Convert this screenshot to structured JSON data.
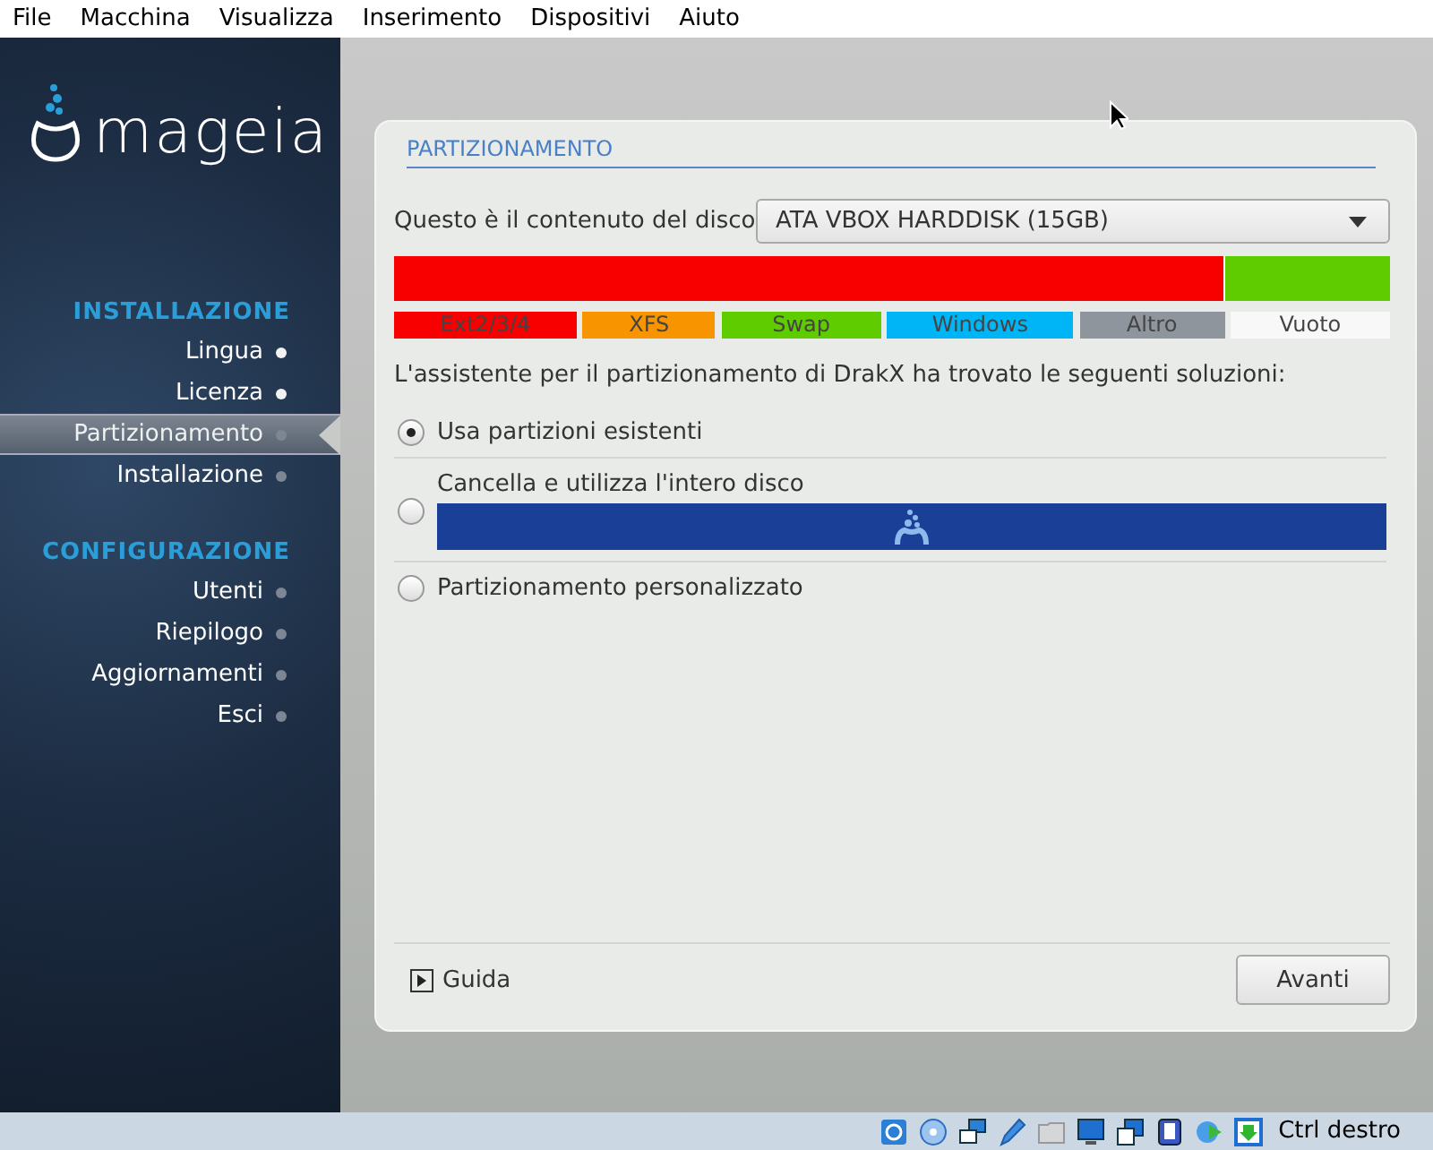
{
  "menu_bar": [
    "File",
    "Macchina",
    "Visualizza",
    "Inserimento",
    "Dispositivi",
    "Aiuto"
  ],
  "sidebar": {
    "logo_text": "mageia",
    "sections": [
      {
        "title": "INSTALLAZIONE",
        "items": [
          {
            "label": "Lingua",
            "done": true,
            "selected": false
          },
          {
            "label": "Licenza",
            "done": true,
            "selected": false
          },
          {
            "label": "Partizionamento",
            "done": false,
            "selected": true
          },
          {
            "label": "Installazione",
            "done": false,
            "selected": false
          }
        ]
      },
      {
        "title": "CONFIGURAZIONE",
        "items": [
          {
            "label": "Utenti",
            "done": false,
            "selected": false
          },
          {
            "label": "Riepilogo",
            "done": false,
            "selected": false
          },
          {
            "label": "Aggiornamenti",
            "done": false,
            "selected": false
          },
          {
            "label": "Esci",
            "done": false,
            "selected": false
          }
        ]
      }
    ]
  },
  "panel": {
    "title": "PARTIZIONAMENTO",
    "disk_label": "Questo è il contenuto del disco",
    "disk_select": "ATA VBOX HARDDISK (15GB)",
    "disk_bar": {
      "level": 0.835
    },
    "legend": [
      {
        "label": "Ext2/3/4",
        "color": "#f80000"
      },
      {
        "label": "XFS",
        "color": "#f79400"
      },
      {
        "label": "Swap",
        "color": "#5fcc00"
      },
      {
        "label": "Windows",
        "color": "#00b5f5"
      },
      {
        "label": "Altro",
        "color": "#8e959c"
      },
      {
        "label": "Vuoto",
        "color": "#f7f8f7"
      }
    ],
    "intro": "L'assistente per il partizionamento di DrakX ha trovato le seguenti soluzioni:",
    "options": [
      {
        "label": "Usa partizioni esistenti",
        "selected": true,
        "kind": "plain"
      },
      {
        "label": "Cancella e utilizza l'intero disco",
        "selected": false,
        "kind": "disk"
      },
      {
        "label": "Partizionamento personalizzato",
        "selected": false,
        "kind": "plain"
      }
    ],
    "help_link": "Guida",
    "next_button": "Avanti"
  },
  "status_bar": {
    "host_key": "Ctrl destro"
  }
}
